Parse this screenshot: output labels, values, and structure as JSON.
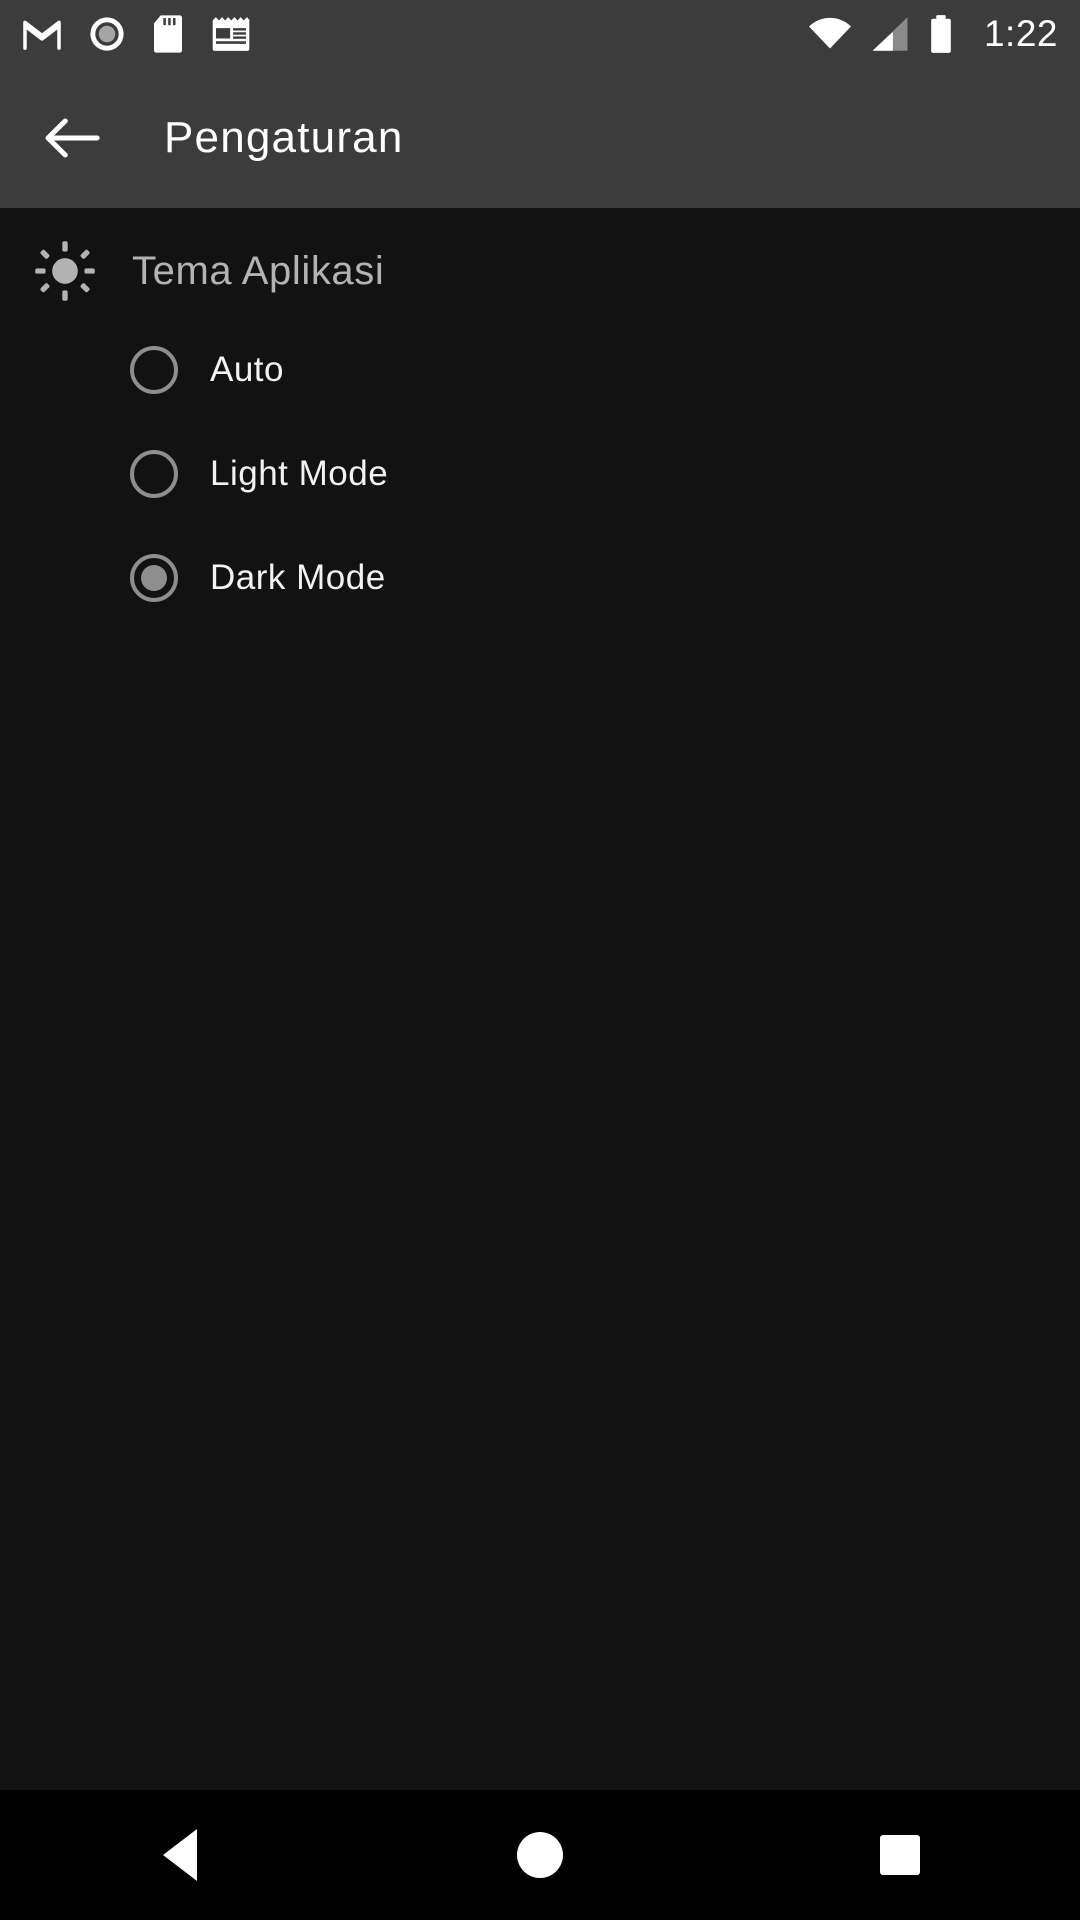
{
  "status_bar": {
    "background": "#3c3c3c",
    "time": "1:22",
    "left_icons": [
      {
        "name": "gmail-icon",
        "label": "M"
      },
      {
        "name": "screen-record-icon",
        "label": ""
      },
      {
        "name": "sd-card-icon",
        "label": ""
      },
      {
        "name": "news-icon",
        "label": ""
      }
    ],
    "right_icons": [
      {
        "name": "wifi-icon",
        "label": ""
      },
      {
        "name": "cellular-signal-icon",
        "label": ""
      },
      {
        "name": "battery-icon",
        "label": ""
      }
    ]
  },
  "app_bar": {
    "background": "#3c3c3c",
    "back_label": "back-arrow",
    "title": "Pengaturan"
  },
  "content": {
    "background": "#121212",
    "section": {
      "icon": "brightness-sun-icon",
      "title": "Tema Aplikasi",
      "title_color": "#b3b3b3"
    },
    "theme_options": [
      {
        "label": "Auto",
        "selected": false
      },
      {
        "label": "Light Mode",
        "selected": false
      },
      {
        "label": "Dark Mode",
        "selected": true
      }
    ],
    "selected_theme": "Dark Mode",
    "radio_color": "#8e8e8e",
    "label_color": "#f2f2f2"
  },
  "nav_bar": {
    "background": "#000000",
    "buttons": [
      {
        "name": "nav-back-button",
        "label": "back"
      },
      {
        "name": "nav-home-button",
        "label": "home"
      },
      {
        "name": "nav-recents-button",
        "label": "recents"
      }
    ]
  }
}
